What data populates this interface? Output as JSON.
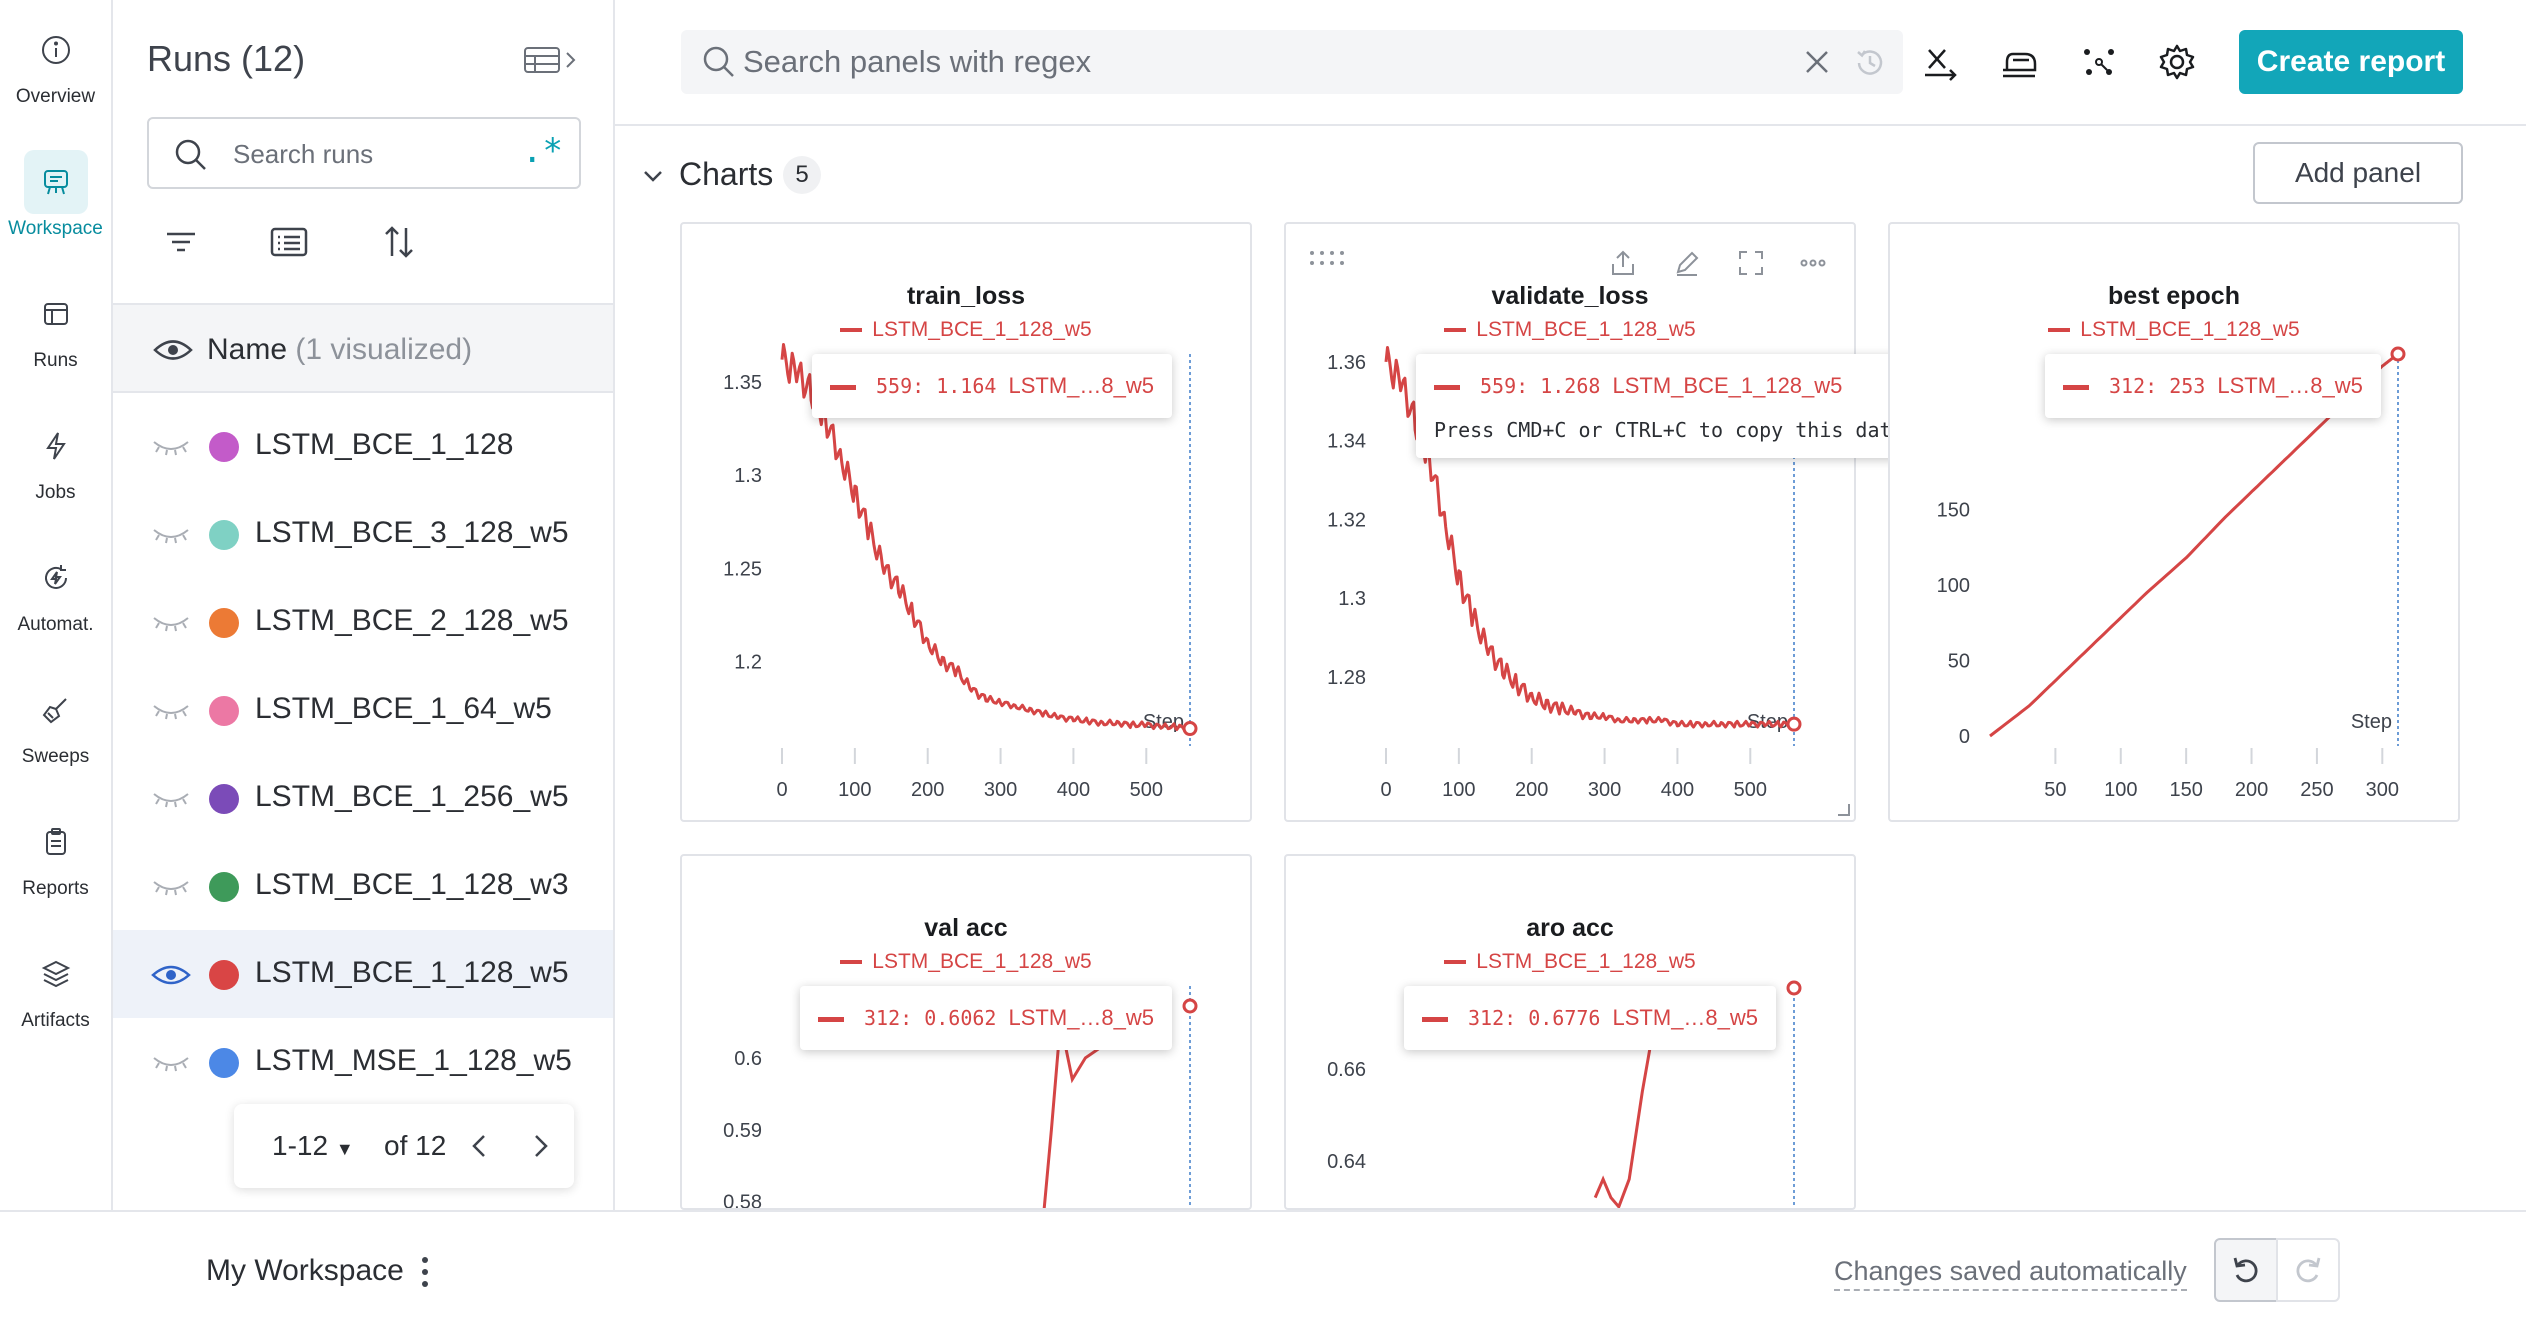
{
  "nav": {
    "items": [
      {
        "label": "Overview",
        "icon": "info-icon"
      },
      {
        "label": "Workspace",
        "icon": "workspace-icon"
      },
      {
        "label": "Runs",
        "icon": "table-icon"
      },
      {
        "label": "Jobs",
        "icon": "bolt-icon"
      },
      {
        "label": "Automat.",
        "icon": "automation-icon"
      },
      {
        "label": "Sweeps",
        "icon": "broom-icon"
      },
      {
        "label": "Reports",
        "icon": "clipboard-icon"
      },
      {
        "label": "Artifacts",
        "icon": "layers-icon"
      }
    ],
    "active": "Workspace"
  },
  "runs_panel": {
    "title": "Runs (12)",
    "search_placeholder": "Search runs",
    "regex_toggle": ".*",
    "name_header": "Name",
    "name_header_sub": "(1 visualized)",
    "runs": [
      {
        "name": "LSTM_BCE_1_128",
        "color": "#c35bc9",
        "visible": false
      },
      {
        "name": "LSTM_BCE_3_128_w5",
        "color": "#7fd1c4",
        "visible": false
      },
      {
        "name": "LSTM_BCE_2_128_w5",
        "color": "#ec7a35",
        "visible": false
      },
      {
        "name": "LSTM_BCE_1_64_w5",
        "color": "#ec78a4",
        "visible": false
      },
      {
        "name": "LSTM_BCE_1_256_w5",
        "color": "#7b4bb8",
        "visible": false
      },
      {
        "name": "LSTM_BCE_1_128_w3",
        "color": "#3e9a5a",
        "visible": false
      },
      {
        "name": "LSTM_BCE_1_128_w5",
        "color": "#d94545",
        "visible": true
      },
      {
        "name": "LSTM_MSE_1_128_w5",
        "color": "#4c88e6",
        "visible": false
      }
    ],
    "pager": {
      "range": "1-12",
      "of": "of 12"
    }
  },
  "topbar": {
    "search_placeholder": "Search panels with regex",
    "create_report": "Create report"
  },
  "section": {
    "title": "Charts",
    "count": "5",
    "add_panel": "Add panel"
  },
  "accent_color": "#12a6b9",
  "series_color": "#d54545",
  "chart_data": [
    {
      "type": "line",
      "title": "train_loss",
      "legend": "LSTM_BCE_1_128_w5",
      "xlabel": "Step",
      "xlim": [
        0,
        560
      ],
      "ylim": [
        1.16,
        1.365
      ],
      "xticks": [
        0,
        100,
        200,
        300,
        400,
        500
      ],
      "yticks": [
        1.2,
        1.25,
        1.3,
        1.35
      ],
      "x": [
        0,
        20,
        40,
        60,
        80,
        100,
        120,
        140,
        160,
        180,
        200,
        220,
        240,
        260,
        280,
        300,
        320,
        340,
        360,
        380,
        400,
        420,
        440,
        460,
        480,
        500,
        520,
        540,
        559
      ],
      "y": [
        1.362,
        1.355,
        1.345,
        1.33,
        1.31,
        1.29,
        1.27,
        1.25,
        1.24,
        1.225,
        1.21,
        1.2,
        1.195,
        1.185,
        1.18,
        1.178,
        1.176,
        1.174,
        1.172,
        1.17,
        1.169,
        1.168,
        1.167,
        1.167,
        1.166,
        1.166,
        1.165,
        1.165,
        1.164
      ],
      "tooltip": {
        "step": "559:",
        "value": "1.164",
        "run": "LSTM_…8_w5"
      }
    },
    {
      "type": "line",
      "title": "validate_loss",
      "legend": "LSTM_BCE_1_128_w5",
      "xlabel": "Step",
      "xlim": [
        0,
        560
      ],
      "ylim": [
        1.265,
        1.362
      ],
      "xticks": [
        0,
        100,
        200,
        300,
        400,
        500
      ],
      "yticks": [
        1.28,
        1.3,
        1.32,
        1.34,
        1.36
      ],
      "x": [
        0,
        20,
        40,
        60,
        80,
        100,
        120,
        140,
        160,
        180,
        200,
        220,
        240,
        260,
        280,
        300,
        320,
        340,
        360,
        380,
        400,
        420,
        440,
        460,
        480,
        500,
        520,
        540,
        559
      ],
      "y": [
        1.36,
        1.355,
        1.345,
        1.335,
        1.32,
        1.305,
        1.295,
        1.287,
        1.282,
        1.278,
        1.275,
        1.273,
        1.272,
        1.271,
        1.27,
        1.27,
        1.269,
        1.269,
        1.269,
        1.269,
        1.268,
        1.268,
        1.268,
        1.268,
        1.268,
        1.268,
        1.268,
        1.268,
        1.268
      ],
      "tooltip": {
        "step": "559:",
        "value": "1.268",
        "run": "LSTM_BCE_1_128_w5",
        "hint": "Press CMD+C or CTRL+C to copy this data"
      }
    },
    {
      "type": "line",
      "title": "best epoch",
      "legend": "LSTM_BCE_1_128_w5",
      "xlabel": "Step",
      "xlim": [
        0,
        312
      ],
      "ylim": [
        0,
        253
      ],
      "xticks": [
        50,
        100,
        150,
        200,
        250,
        300
      ],
      "yticks": [
        0,
        50,
        100,
        150
      ],
      "x": [
        0,
        30,
        60,
        90,
        120,
        150,
        180,
        210,
        240,
        270,
        300,
        312
      ],
      "y": [
        0,
        20,
        45,
        70,
        95,
        118,
        145,
        170,
        195,
        220,
        245,
        253
      ],
      "tooltip": {
        "step": "312:",
        "value": "253",
        "run": "LSTM_…8_w5"
      }
    },
    {
      "type": "line",
      "title": "val acc",
      "legend": "LSTM_BCE_1_128_w5",
      "xlabel": "Step",
      "xlim": [
        0,
        312
      ],
      "ylim": [
        0.578,
        0.61
      ],
      "yticks": [
        0.58,
        0.59,
        0.6
      ],
      "tooltip": {
        "step": "312:",
        "value": "0.6062",
        "run": "LSTM_…8_w5"
      }
    },
    {
      "type": "line",
      "title": "aro acc",
      "legend": "LSTM_BCE_1_128_w5",
      "xlabel": "Step",
      "xlim": [
        0,
        312
      ],
      "ylim": [
        0.628,
        0.678
      ],
      "yticks": [
        0.64,
        0.66
      ],
      "tooltip": {
        "step": "312:",
        "value": "0.6776",
        "run": "LSTM_…8_w5"
      }
    }
  ],
  "footer": {
    "workspace": "My Workspace",
    "saved": "Changes saved automatically"
  }
}
